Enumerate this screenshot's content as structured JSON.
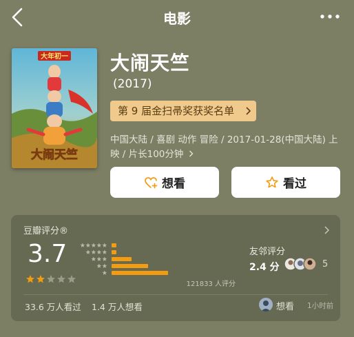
{
  "nav": {
    "title": "电影",
    "back_icon": "chevron-left-icon",
    "more_icon": "more-dots-icon"
  },
  "movie": {
    "title": "大闹天竺",
    "year": "(2017)",
    "award": "第 9 届金扫帚奖获奖名单",
    "meta": "中国大陆 / 喜剧 动作 冒险 / 2017-01-28(中国大陆) 上映 / 片长100分钟",
    "poster_text": {
      "top_banner": "大年初一",
      "title_art": "大闹天竺"
    }
  },
  "actions": {
    "want_label": "想看",
    "want_icon": "heart-plus-icon",
    "seen_label": "看过",
    "seen_icon": "star-outline-icon"
  },
  "rating": {
    "heading": "豆瓣评分®",
    "score": "3.7",
    "stars_value": 2,
    "stars_max": 5,
    "distribution": [
      {
        "stars": 5,
        "fraction": 0.04
      },
      {
        "stars": 4,
        "fraction": 0.04
      },
      {
        "stars": 3,
        "fraction": 0.16
      },
      {
        "stars": 2,
        "fraction": 0.3
      },
      {
        "stars": 1,
        "fraction": 0.46
      }
    ],
    "count": "121833 人评分",
    "friend_label": "友邻评分",
    "friend_score": "2.4 分",
    "friend_count": "5",
    "seen_count": "33.6 万人看过",
    "want_count": "1.4 万人想看",
    "activity_action": "想看",
    "activity_time": "1小时前",
    "accent_color": "#f39c12"
  }
}
